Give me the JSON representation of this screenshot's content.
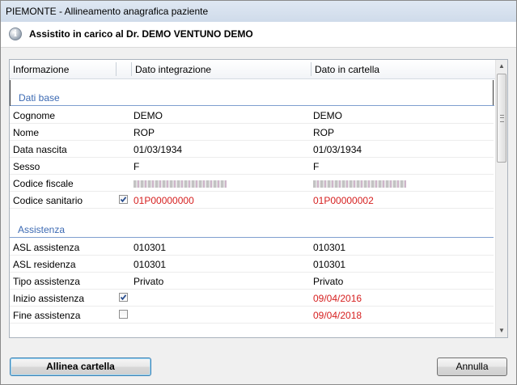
{
  "window": {
    "title": "PIEMONTE - Allineamento anagrafica paziente"
  },
  "infobar": {
    "icon": "info-icon",
    "message": "Assistito in carico al Dr. DEMO VENTUNO DEMO"
  },
  "table": {
    "columns": [
      "Informazione",
      "Dato integrazione",
      "Dato in cartella"
    ],
    "sections": [
      {
        "title": "Dati base",
        "rows": [
          {
            "label": "Cognome",
            "integrazione": "DEMO",
            "cartella": "DEMO",
            "checkbox": null,
            "highlight": false
          },
          {
            "label": "Nome",
            "integrazione": "ROP",
            "cartella": "ROP",
            "checkbox": null,
            "highlight": false
          },
          {
            "label": "Data nascita",
            "integrazione": "01/03/1934",
            "cartella": "01/03/1934",
            "checkbox": null,
            "highlight": false
          },
          {
            "label": "Sesso",
            "integrazione": "F",
            "cartella": "F",
            "checkbox": null,
            "highlight": false
          },
          {
            "label": "Codice fiscale",
            "integrazione": "",
            "cartella": "",
            "checkbox": null,
            "highlight": false,
            "redacted": true
          },
          {
            "label": "Codice sanitario",
            "integrazione": "01P00000000",
            "cartella": "01P00000002",
            "checkbox": true,
            "highlight": true
          }
        ]
      },
      {
        "title": "Assistenza",
        "rows": [
          {
            "label": "ASL assistenza",
            "integrazione": "010301",
            "cartella": "010301",
            "checkbox": null,
            "highlight": false
          },
          {
            "label": "ASL residenza",
            "integrazione": "010301",
            "cartella": "010301",
            "checkbox": null,
            "highlight": false
          },
          {
            "label": "Tipo assistenza",
            "integrazione": "Privato",
            "cartella": "Privato",
            "checkbox": null,
            "highlight": false
          },
          {
            "label": "Inizio assistenza",
            "integrazione": "",
            "cartella": "09/04/2016",
            "checkbox": true,
            "highlight": true
          },
          {
            "label": "Fine assistenza",
            "integrazione": "",
            "cartella": "09/04/2018",
            "checkbox": false,
            "highlight": true
          }
        ]
      }
    ]
  },
  "buttons": {
    "align": "Allinea cartella",
    "cancel": "Annulla"
  },
  "colors": {
    "section_title": "#3c6ab3",
    "diff_value": "#d62020",
    "checkbox_mark": "#2b4f8f"
  }
}
